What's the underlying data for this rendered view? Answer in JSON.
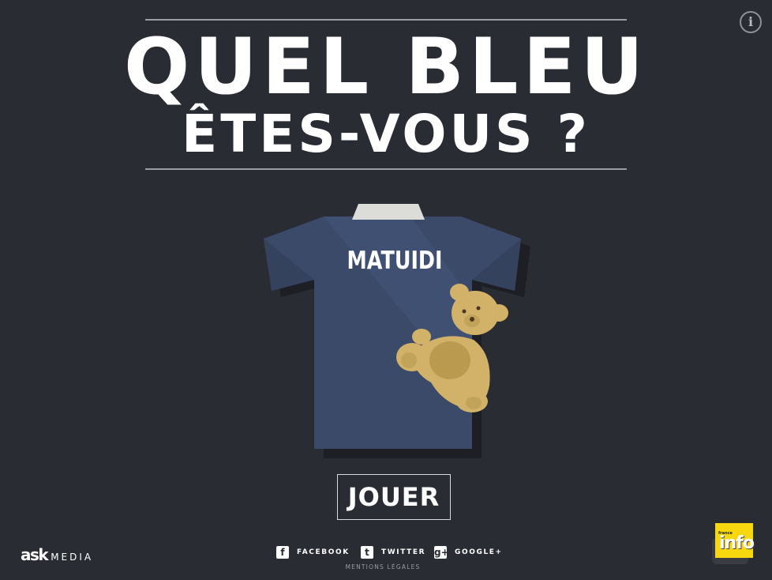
{
  "header": {
    "title_line1": "QUEL BLEU",
    "title_line2": "ÊTES-VOUS ?"
  },
  "info_button": {
    "label": "i",
    "icon": "info-icon"
  },
  "jersey": {
    "name": "MATUIDI",
    "shirt_color": "#3b4a69",
    "collar_color": "#dcdcd8",
    "teddy_color": "#d2b268"
  },
  "play_button": {
    "label": "JOUER"
  },
  "footer": {
    "brand": {
      "ask": "ask",
      "media": "MEDIA"
    },
    "social": [
      {
        "icon": "facebook-icon",
        "glyph": "f",
        "label": "FACEBOOK"
      },
      {
        "icon": "twitter-icon",
        "glyph": "t",
        "label": "TWITTER"
      },
      {
        "icon": "google-plus-icon",
        "glyph": "g+",
        "label": "GOOGLE+"
      }
    ],
    "mentions": "MENTIONS LÉGALES",
    "partner": {
      "small": "france",
      "big": "info"
    }
  },
  "colors": {
    "background": "#2a2c34",
    "rule": "#9a9ca3",
    "partner_yellow": "#f7d70d"
  }
}
